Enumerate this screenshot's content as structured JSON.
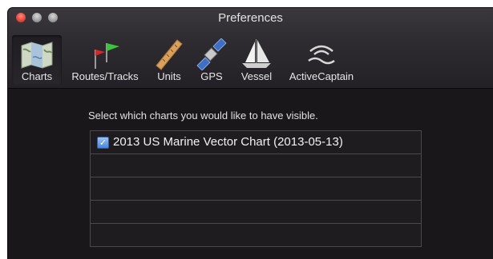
{
  "window": {
    "title": "Preferences"
  },
  "toolbar": {
    "items": [
      {
        "label": "Charts",
        "icon": "map-icon",
        "selected": true
      },
      {
        "label": "Routes/Tracks",
        "icon": "flag-icon",
        "selected": false
      },
      {
        "label": "Units",
        "icon": "ruler-icon",
        "selected": false
      },
      {
        "label": "GPS",
        "icon": "satellite-icon",
        "selected": false
      },
      {
        "label": "Vessel",
        "icon": "sailboat-icon",
        "selected": false
      },
      {
        "label": "ActiveCaptain",
        "icon": "wireless-signal-icon",
        "selected": false
      }
    ]
  },
  "charts_pane": {
    "instruction": "Select which charts you would like to have visible.",
    "charts": [
      {
        "name": "2013 US Marine Vector Chart (2013-05-13)",
        "checked": true
      }
    ],
    "empty_rows": 4
  },
  "colors": {
    "background": "#1a181b",
    "checkbox_blue": "#4a86d6",
    "flag_green": "#3cc43c",
    "flag_red": "#d8262a"
  }
}
